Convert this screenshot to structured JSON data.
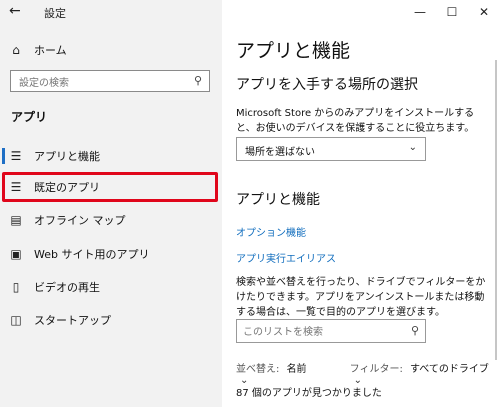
{
  "window": {
    "title": "設定",
    "back_icon": "arrow-left-icon",
    "controls": [
      "minimize-icon",
      "maximize-icon",
      "close-icon"
    ]
  },
  "sidebar": {
    "home_label": "ホーム",
    "search_placeholder": "設定の検索",
    "section_header": "アプリ",
    "items": [
      {
        "label": "アプリと機能",
        "icon": "apps-list-icon",
        "active": true
      },
      {
        "label": "既定のアプリ",
        "icon": "default-apps-icon",
        "highlighted": true
      },
      {
        "label": "オフライン マップ",
        "icon": "offline-map-icon"
      },
      {
        "label": "Web サイト用のアプリ",
        "icon": "website-apps-icon"
      },
      {
        "label": "ビデオの再生",
        "icon": "video-playback-icon"
      },
      {
        "label": "スタートアップ",
        "icon": "startup-icon"
      }
    ]
  },
  "main": {
    "title": "アプリと機能",
    "install_source_heading": "アプリを入手する場所の選択",
    "install_source_desc": "Microsoft Store からのみアプリをインストールすると、お使いのデバイスを保護することに役立ちます。",
    "install_source_value": "場所を選ばない",
    "section_title": "アプリと機能",
    "links": {
      "optional_features": "オプション機能",
      "app_execution_aliases": "アプリ実行エイリアス"
    },
    "list_desc": "検索や並べ替えを行ったり、ドライブでフィルターをかけたりできます。アプリをアンインストールまたは移動する場合は、一覧で目的のアプリを選びます。",
    "list_search_placeholder": "このリストを検索",
    "sort": {
      "label": "並べ替え:",
      "value": "名前"
    },
    "filter": {
      "label": "フィルター:",
      "value": "すべてのドライブ"
    },
    "count_text": "87 個のアプリが見つかりました"
  },
  "colors": {
    "accent": "#1f6fc5",
    "link": "#0f6cbd",
    "highlight": "#e0061b",
    "sidebar_bg": "#f2f2f2"
  }
}
